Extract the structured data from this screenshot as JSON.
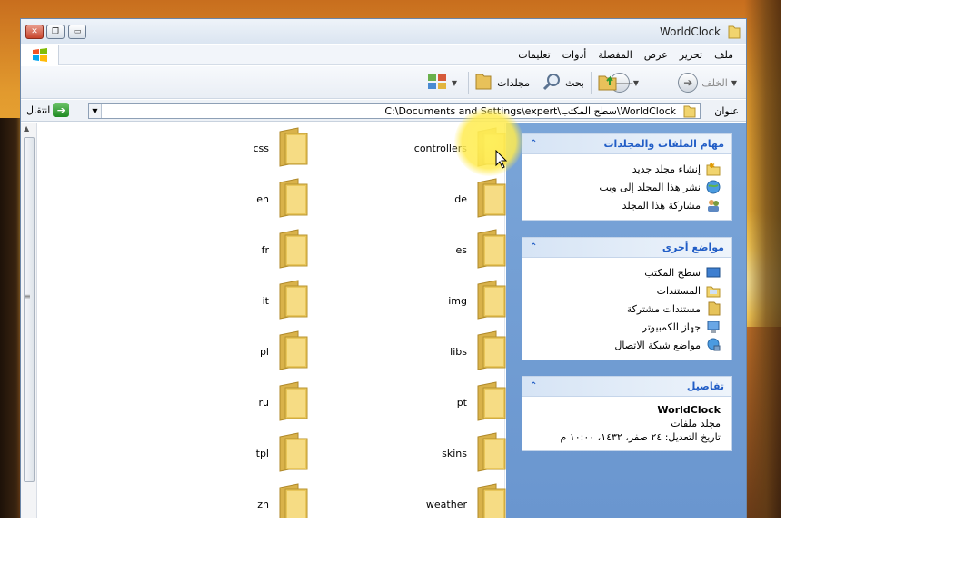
{
  "window": {
    "title": "WorldClock",
    "controls": {
      "close": "✕",
      "maximize": "❐",
      "minimize": "▭"
    }
  },
  "menu": [
    "ملف",
    "تحرير",
    "عرض",
    "المفضلة",
    "أدوات",
    "تعليمات"
  ],
  "toolbar": {
    "back": "الخلف",
    "search": "بحث",
    "folders": "مجلدات"
  },
  "address": {
    "label": "عنوان",
    "path": "C:\\Documents and Settings\\expert\\سطح المكتب\\WorldClock",
    "go": "انتقال"
  },
  "files": {
    "left_column": [
      "css",
      "en",
      "fr",
      "it",
      "pl",
      "ru",
      "tpl",
      "zh"
    ],
    "right_column": [
      "controllers",
      "de",
      "es",
      "img",
      "libs",
      "pt",
      "skins",
      "weather"
    ]
  },
  "tasks_panel": {
    "title": "مهام الملفات والمجلدات",
    "items": [
      "إنشاء مجلد جديد",
      "نشر هذا المجلد إلى ويب",
      "مشاركة هذا المجلد"
    ]
  },
  "places_panel": {
    "title": "مواضع أخرى",
    "items": [
      "سطح المكتب",
      "المستندات",
      "مستندات مشتركة",
      "جهاز الكمبيوتر",
      "مواضع شبكة الاتصال"
    ]
  },
  "details_panel": {
    "title": "تفاصيل",
    "name": "WorldClock",
    "type": "مجلد ملفات",
    "modified": "تاريخ التعديل: ٢٤ صفر، ١٤٣٢، ١٠:٠٠ م"
  },
  "colors": {
    "taskpane": "#6a96cf",
    "panel_title": "#215dc6",
    "folder": "#e9c65a"
  }
}
